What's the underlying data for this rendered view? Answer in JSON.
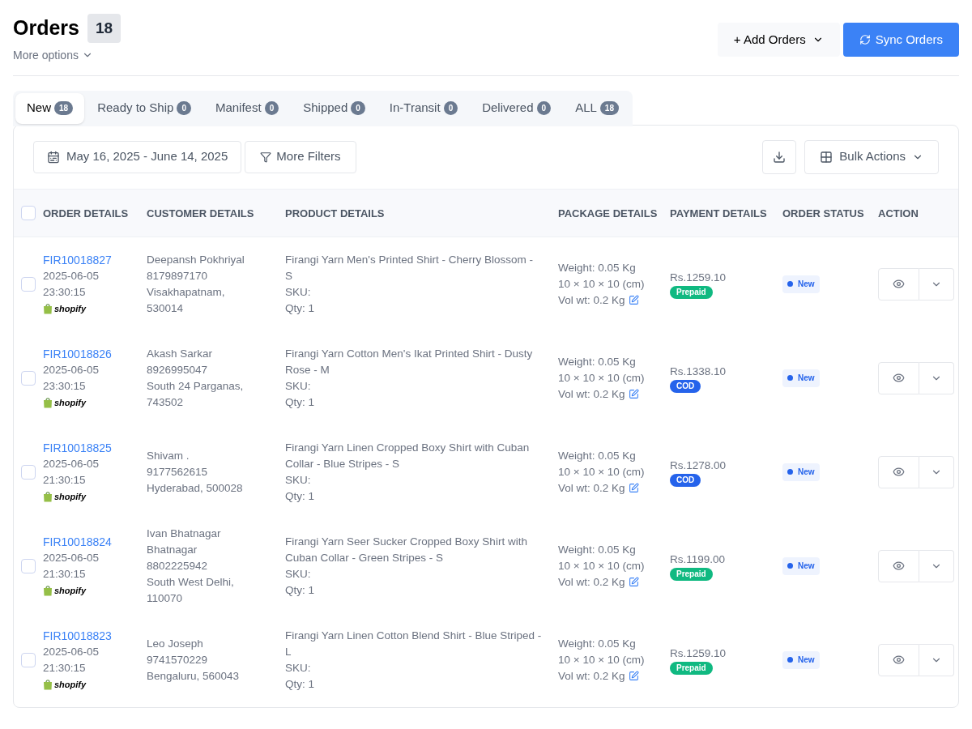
{
  "header": {
    "title": "Orders",
    "count": "18",
    "more_options": "More options",
    "add_button": "+ Add Orders",
    "sync_button": "Sync Orders"
  },
  "tabs": [
    {
      "label": "New",
      "count": "18",
      "selected": true
    },
    {
      "label": "Ready to Ship",
      "count": "0",
      "selected": false
    },
    {
      "label": "Manifest",
      "count": "0",
      "selected": false
    },
    {
      "label": "Shipped",
      "count": "0",
      "selected": false
    },
    {
      "label": "In-Transit",
      "count": "0",
      "selected": false
    },
    {
      "label": "Delivered",
      "count": "0",
      "selected": false
    },
    {
      "label": "ALL",
      "count": "18",
      "selected": false
    }
  ],
  "toolbar": {
    "date_range": "May 16, 2025 - June 14, 2025",
    "filters": "More Filters",
    "bulk_actions": "Bulk Actions"
  },
  "table": {
    "select_all_checked": false,
    "columns": [
      "ORDER DETAILS",
      "CUSTOMER DETAILS",
      "PRODUCT DETAILS",
      "PACKAGE DETAILS",
      "PAYMENT DETAILS",
      "ORDER STATUS",
      "ACTION"
    ],
    "rows": [
      {
        "checked": false,
        "order_id": "FIR10018827",
        "date": "2025-06-05",
        "time": "23:30:15",
        "source": "shopify",
        "customer": [
          "Deepansh Pokhriyal",
          "8179897170",
          "Visakhapatnam,",
          "530014"
        ],
        "product": "Firangi Yarn Men's Printed Shirt - Cherry Blossom - S",
        "sku": "SKU:",
        "qty": "Qty: 1",
        "weight": "Weight: 0.05 Kg",
        "dimensions": "10 × 10 × 10 (cm)",
        "vol_wt": "Vol wt: 0.2 Kg",
        "amount": "Rs.1259.10",
        "payment": {
          "label": "Prepaid",
          "kind": "prepaid"
        },
        "status": "New"
      },
      {
        "checked": false,
        "order_id": "FIR10018826",
        "date": "2025-06-05",
        "time": "23:30:15",
        "source": "shopify",
        "customer": [
          "Akash Sarkar",
          "8926995047",
          "South 24 Parganas,",
          "743502"
        ],
        "product": "Firangi Yarn Cotton Men's Ikat Printed Shirt - Dusty Rose - M",
        "sku": "SKU:",
        "qty": "Qty: 1",
        "weight": "Weight: 0.05 Kg",
        "dimensions": "10 × 10 × 10 (cm)",
        "vol_wt": "Vol wt: 0.2 Kg",
        "amount": "Rs.1338.10",
        "payment": {
          "label": "COD",
          "kind": "cod"
        },
        "status": "New"
      },
      {
        "checked": false,
        "order_id": "FIR10018825",
        "date": "2025-06-05",
        "time": "21:30:15",
        "source": "shopify",
        "customer": [
          "Shivam .",
          "9177562615",
          "Hyderabad, 500028"
        ],
        "product": "Firangi Yarn Linen Cropped Boxy Shirt with Cuban Collar - Blue Stripes - S",
        "sku": "SKU:",
        "qty": "Qty: 1",
        "weight": "Weight: 0.05 Kg",
        "dimensions": "10 × 10 × 10 (cm)",
        "vol_wt": "Vol wt: 0.2 Kg",
        "amount": "Rs.1278.00",
        "payment": {
          "label": "COD",
          "kind": "cod"
        },
        "status": "New"
      },
      {
        "checked": false,
        "order_id": "FIR10018824",
        "date": "2025-06-05",
        "time": "21:30:15",
        "source": "shopify",
        "customer": [
          "Ivan Bhatnagar",
          "Bhatnagar",
          "8802225942",
          "South West Delhi,",
          "110070"
        ],
        "product": "Firangi Yarn Seer Sucker Cropped Boxy Shirt with Cuban Collar - Green Stripes - S",
        "sku": "SKU:",
        "qty": "Qty: 1",
        "weight": "Weight: 0.05 Kg",
        "dimensions": "10 × 10 × 10 (cm)",
        "vol_wt": "Vol wt: 0.2 Kg",
        "amount": "Rs.1199.00",
        "payment": {
          "label": "Prepaid",
          "kind": "prepaid"
        },
        "status": "New"
      },
      {
        "checked": false,
        "order_id": "FIR10018823",
        "date": "2025-06-05",
        "time": "21:30:15",
        "source": "shopify",
        "customer": [
          "Leo Joseph",
          "9741570229",
          "Bengaluru, 560043"
        ],
        "product": "Firangi Yarn Linen Cotton Blend Shirt - Blue Striped - L",
        "sku": "SKU:",
        "qty": "Qty: 1",
        "weight": "Weight: 0.05 Kg",
        "dimensions": "10 × 10 × 10 (cm)",
        "vol_wt": "Vol wt: 0.2 Kg",
        "amount": "Rs.1259.10",
        "payment": {
          "label": "Prepaid",
          "kind": "prepaid"
        },
        "status": "New"
      }
    ]
  }
}
